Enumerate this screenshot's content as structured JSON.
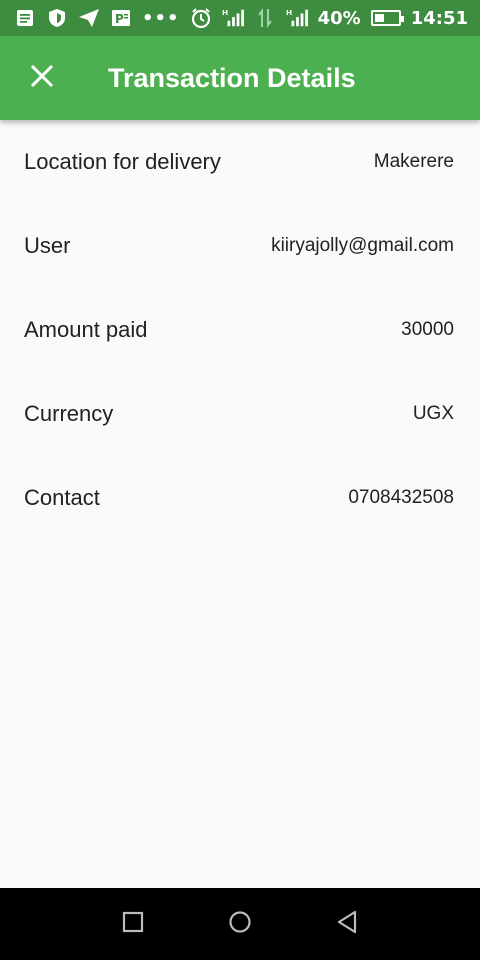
{
  "status_bar": {
    "battery": "40%",
    "time": "14:51",
    "dots": "•••",
    "icons": [
      "notes-icon",
      "shield-icon",
      "send-icon",
      "powerpoint-icon",
      "alarm-icon",
      "signal-icon",
      "data-arrows-icon",
      "signal-icon",
      "battery-icon"
    ],
    "battery_level": 0.4
  },
  "app_bar": {
    "title": "Transaction Details",
    "close_icon": "close-icon",
    "background": "#4caf50",
    "status_background": "#3d8c40"
  },
  "details": [
    {
      "label": "Location for delivery",
      "value": "Makerere"
    },
    {
      "label": "User",
      "value": "kiiryajolly@gmail.com"
    },
    {
      "label": "Amount paid",
      "value": "30000"
    },
    {
      "label": "Currency",
      "value": "UGX"
    },
    {
      "label": "Contact",
      "value": "0708432508"
    }
  ],
  "nav_bar": {
    "icons": [
      "recents-icon",
      "home-icon",
      "back-icon"
    ]
  }
}
